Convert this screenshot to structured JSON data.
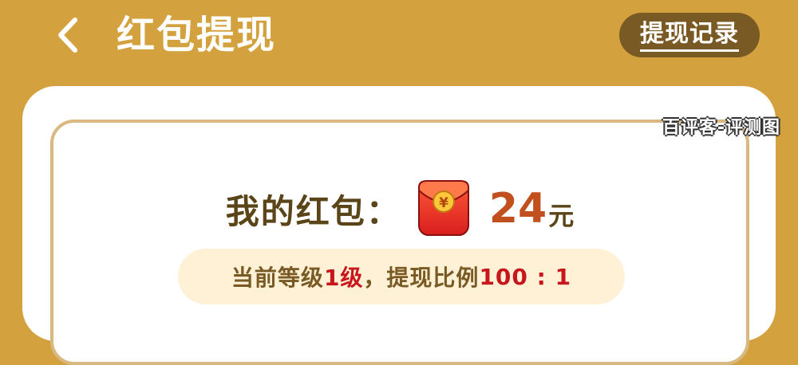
{
  "header": {
    "title": "红包提现",
    "record_button_label": "提现记录"
  },
  "watermark": "百评客-评测图",
  "balance": {
    "label": "我的红包：",
    "amount": "24",
    "unit": "元",
    "envelope_symbol": "¥"
  },
  "level_info": {
    "prefix": "当前等级",
    "level": "1级",
    "separator": "，提现比例",
    "ratio": "100 : 1"
  },
  "colors": {
    "background": "#D4A13F",
    "accent_dark": "#7A5A24",
    "amount": "#C2501E",
    "highlight": "#C8161D"
  }
}
